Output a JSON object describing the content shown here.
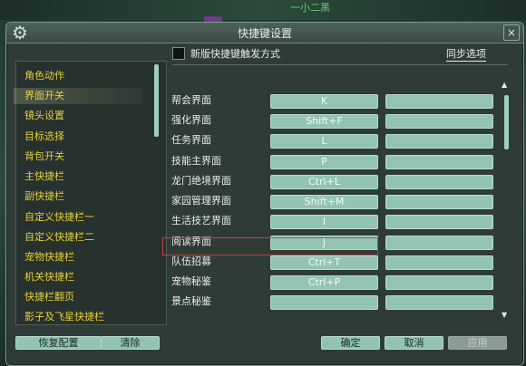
{
  "background": {
    "overlay_text": "一小二黑"
  },
  "window": {
    "title": "快捷键设置",
    "close_icon": "×"
  },
  "left_list": {
    "items": [
      {
        "label": "角色动作",
        "selected": false
      },
      {
        "label": "界面开关",
        "selected": true
      },
      {
        "label": "镜头设置",
        "selected": false
      },
      {
        "label": "目标选择",
        "selected": false
      },
      {
        "label": "背包开关",
        "selected": false
      },
      {
        "label": "主快捷栏",
        "selected": false
      },
      {
        "label": "副快捷栏",
        "selected": false
      },
      {
        "label": "自定义快捷栏一",
        "selected": false
      },
      {
        "label": "自定义快捷栏二",
        "selected": false
      },
      {
        "label": "宠物快捷栏",
        "selected": false
      },
      {
        "label": "机关快捷栏",
        "selected": false
      },
      {
        "label": "快捷栏翻页",
        "selected": false
      },
      {
        "label": "影子及飞星快捷栏",
        "selected": false
      }
    ]
  },
  "options": {
    "new_trigger_label": "新版快捷键触发方式",
    "new_trigger_checked": false,
    "sync_label": "同步选项"
  },
  "bindings": [
    {
      "action": "帮会界面",
      "key1": "K",
      "key2": ""
    },
    {
      "action": "强化界面",
      "key1": "Shift+F",
      "key2": ""
    },
    {
      "action": "任务界面",
      "key1": "L",
      "key2": ""
    },
    {
      "action": "技能主界面",
      "key1": "P",
      "key2": ""
    },
    {
      "action": "龙门绝境界面",
      "key1": "Ctrl+L",
      "key2": ""
    },
    {
      "action": "家园管理界面",
      "key1": "Shift+M",
      "key2": ""
    },
    {
      "action": "生活技艺界面",
      "key1": "I",
      "key2": ""
    },
    {
      "action": "阅读界面",
      "key1": "J",
      "key2": "",
      "highlighted": true
    },
    {
      "action": "队伍招募",
      "key1": "Ctrl+T",
      "key2": ""
    },
    {
      "action": "宠物秘鉴",
      "key1": "Ctrl+P",
      "key2": ""
    },
    {
      "action": "景点秘鉴",
      "key1": "",
      "key2": ""
    }
  ],
  "buttons": {
    "restore": "恢复配置",
    "clear": "清除",
    "ok": "确定",
    "cancel": "取消",
    "apply": "应用"
  },
  "icons": {
    "settings": "gear-icon",
    "close": "close-icon",
    "scroll_up": "triangle-up-icon",
    "scroll_down": "triangle-down-icon"
  }
}
